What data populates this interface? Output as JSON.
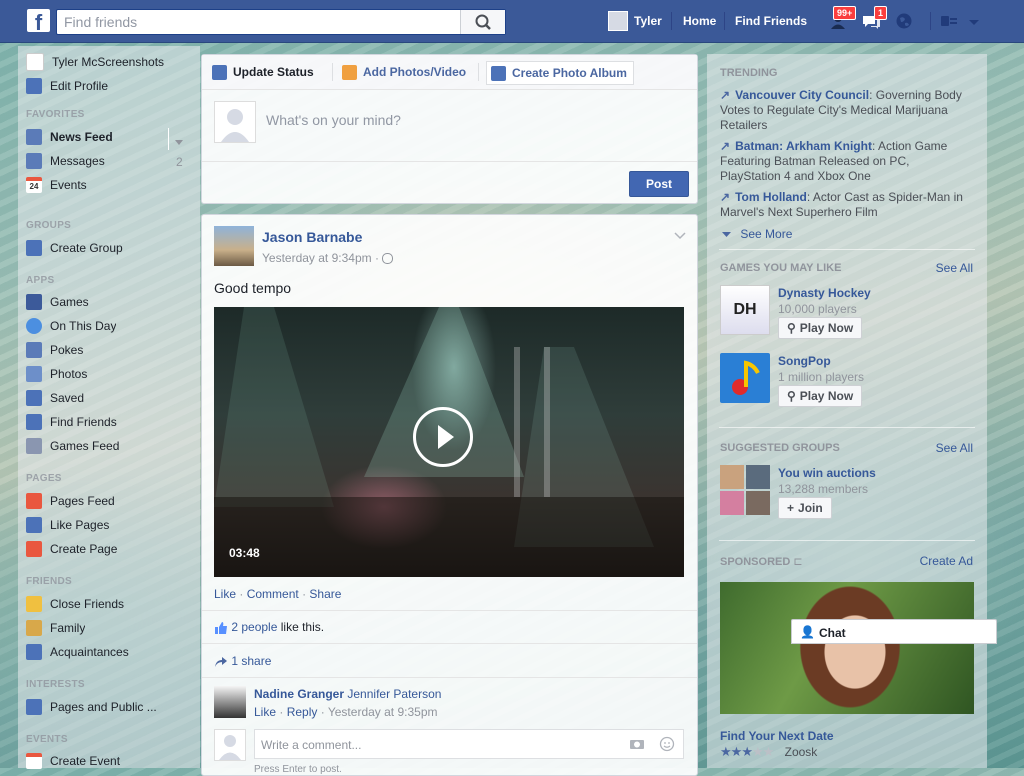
{
  "topbar": {
    "logo": "f",
    "search_placeholder": "Find friends",
    "profile_name": "Tyler",
    "home": "Home",
    "find_friends": "Find Friends",
    "friend_requests_badge": "99+",
    "messages_badge": "1"
  },
  "left_nav": {
    "profile_name": "Tyler McScreenshots",
    "edit_profile": "Edit Profile",
    "favorites_header": "FAVORITES",
    "news_feed": "News Feed",
    "messages": "Messages",
    "messages_count": "2",
    "events": "Events",
    "events_icon_num": "24",
    "groups_header": "GROUPS",
    "create_group": "Create Group",
    "apps_header": "APPS",
    "apps": [
      "Games",
      "On This Day",
      "Pokes",
      "Photos",
      "Saved",
      "Find Friends",
      "Games Feed"
    ],
    "pages_header": "PAGES",
    "pages": [
      "Pages Feed",
      "Like Pages",
      "Create Page"
    ],
    "friends_header": "FRIENDS",
    "friends": [
      "Close Friends",
      "Family",
      "Acquaintances"
    ],
    "interests_header": "INTERESTS",
    "interests_item": "Pages and Public ...",
    "events_header": "EVENTS",
    "create_event": "Create Event"
  },
  "composer": {
    "tab_status": "Update Status",
    "tab_photos": "Add Photos/Video",
    "tab_album": "Create Photo Album",
    "placeholder": "What's on your mind?",
    "post_button": "Post"
  },
  "post": {
    "author": "Jason Barnabe",
    "time": "Yesterday at 9:34pm",
    "privacy_sep": "·",
    "text": "Good tempo",
    "video_duration": "03:48",
    "actions": [
      "Like",
      "Comment",
      "Share"
    ],
    "likes_count": "2 people",
    "likes_suffix": "like this.",
    "shares": "1 share",
    "comment": {
      "author": "Nadine Granger",
      "mention": "Jennifer Paterson",
      "like": "Like",
      "reply": "Reply",
      "time": "Yesterday at 9:35pm"
    },
    "comment_placeholder": "Write a comment...",
    "enter_hint": "Press Enter to post."
  },
  "right_col": {
    "trending_header": "TRENDING",
    "trending": [
      {
        "topic": "Vancouver City Council",
        "desc": ": Governing Body Votes to Regulate City's Medical Marijuana Retailers"
      },
      {
        "topic": "Batman: Arkham Knight",
        "desc": ": Action Game Featuring Batman Released on PC, PlayStation 4 and Xbox One"
      },
      {
        "topic": "Tom Holland",
        "desc": ": Actor Cast as Spider-Man in Marvel's Next Superhero Film"
      }
    ],
    "see_more": "See More",
    "games_header": "GAMES YOU MAY LIKE",
    "see_all": "See All",
    "games": [
      {
        "name": "Dynasty Hockey",
        "players": "10,000 players",
        "button": "Play Now",
        "logo_text": "DH"
      },
      {
        "name": "SongPop",
        "players": "1 million players",
        "button": "Play Now"
      }
    ],
    "groups_header": "SUGGESTED GROUPS",
    "group": {
      "name": "You win auctions",
      "members": "13,288 members",
      "button": "Join"
    },
    "sponsored_header": "SPONSORED",
    "create_ad": "Create Ad",
    "ad_title": "Find Your Next Date",
    "ad_rating": 3,
    "ad_source": "Zoosk"
  },
  "chat": {
    "label": "Chat"
  },
  "colors": {
    "brand": "#3b5998",
    "link": "#365899",
    "badge": "#fa3e3e"
  }
}
